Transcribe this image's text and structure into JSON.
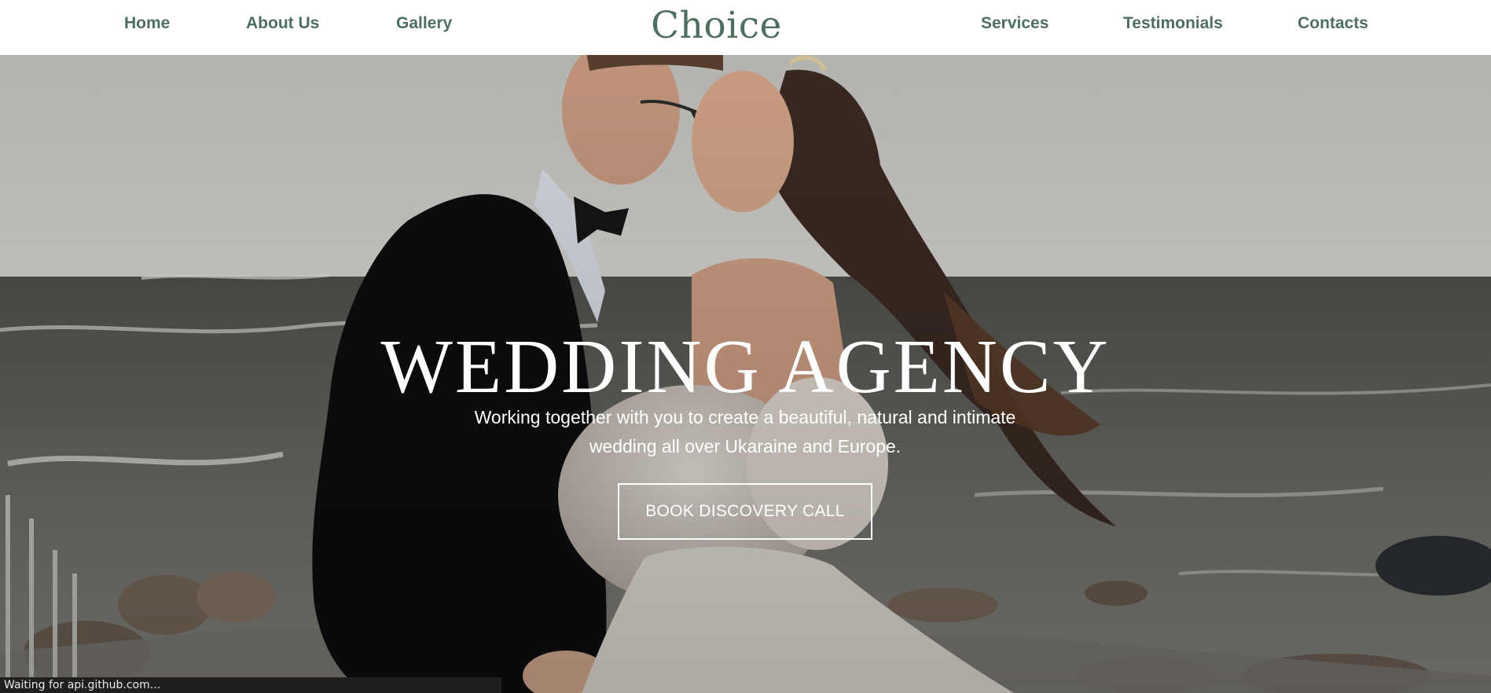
{
  "header": {
    "logo": "Choice",
    "nav_left": [
      {
        "label": "Home"
      },
      {
        "label": "About Us"
      },
      {
        "label": "Gallery"
      }
    ],
    "nav_right": [
      {
        "label": "Services"
      },
      {
        "label": "Testimonials"
      },
      {
        "label": "Contacts"
      }
    ],
    "text_color": "#4e6e5f"
  },
  "hero": {
    "title": "WEDDING AGENCY",
    "subtitle": "Working together with you to create a beautiful, natural and intimate wedding all over Ukaraine and Europe.",
    "cta_label": "BOOK DISCOVERY CALL",
    "image": "wedding-couple-kissing-by-sea-photo"
  },
  "status_bar": {
    "text": "Waiting for api.github.com..."
  }
}
